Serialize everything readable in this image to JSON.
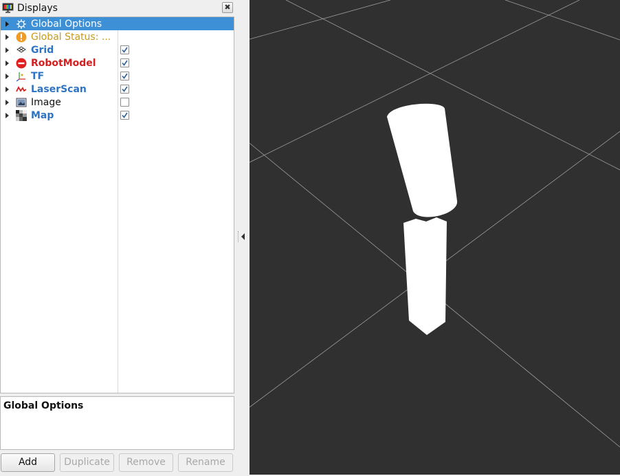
{
  "dock": {
    "title": "Displays",
    "close_label": "✖"
  },
  "tree": {
    "items": [
      {
        "label": "Global Options",
        "icon": "gear-icon",
        "color": "#ffffff",
        "bold": false,
        "checked": null,
        "selected": true
      },
      {
        "label": "Global Status: ...",
        "icon": "warning-icon",
        "color": "#c99a1a",
        "bold": false,
        "checked": null,
        "selected": false
      },
      {
        "label": "Grid",
        "icon": "grid-icon",
        "color": "#2f74c4",
        "bold": true,
        "checked": true,
        "selected": false
      },
      {
        "label": "RobotModel",
        "icon": "error-icon",
        "color": "#d32020",
        "bold": true,
        "checked": true,
        "selected": false
      },
      {
        "label": "TF",
        "icon": "tf-axes-icon",
        "color": "#2f74c4",
        "bold": true,
        "checked": true,
        "selected": false
      },
      {
        "label": "LaserScan",
        "icon": "laserscan-icon",
        "color": "#2f74c4",
        "bold": true,
        "checked": true,
        "selected": false
      },
      {
        "label": "Image",
        "icon": "image-icon",
        "color": "#111111",
        "bold": false,
        "checked": false,
        "selected": false
      },
      {
        "label": "Map",
        "icon": "map-icon",
        "color": "#2f74c4",
        "bold": true,
        "checked": true,
        "selected": false
      }
    ]
  },
  "description": {
    "title": "Global Options"
  },
  "buttons": {
    "add": "Add",
    "duplicate": "Duplicate",
    "remove": "Remove",
    "rename": "Rename"
  },
  "colors": {
    "selection": "#3d8fd6",
    "viewport_bg": "#303030",
    "grid_line": "#a0a0a0",
    "robot": "#ffffff"
  }
}
